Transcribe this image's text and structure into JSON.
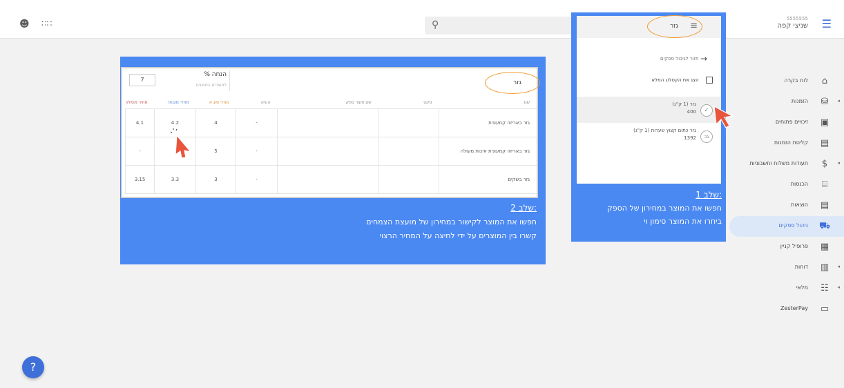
{
  "header": {
    "brand_number": "5555555",
    "brand_name": "שניצי קפה",
    "search_placeholder": ""
  },
  "sidebar": {
    "items": [
      {
        "label": "לוח בקרה",
        "icon": "home-icon",
        "has_arrow": false
      },
      {
        "label": "הזמנות",
        "icon": "cart-icon",
        "has_arrow": true
      },
      {
        "label": "זיכויים פתוחים",
        "icon": "clipboard-icon",
        "has_arrow": false
      },
      {
        "label": "קליטת הזמנות",
        "icon": "clipboard-list-icon",
        "has_arrow": false
      },
      {
        "label": "תעודות משלוח וחשבוניות",
        "icon": "dollar-icon",
        "has_arrow": true
      },
      {
        "label": "הכנסות",
        "icon": "cash-register-icon",
        "has_arrow": false
      },
      {
        "label": "הוצאות",
        "icon": "receipt-icon",
        "has_arrow": false
      },
      {
        "label": "ניהול ספקים",
        "icon": "truck-icon",
        "has_arrow": false,
        "active": true
      },
      {
        "label": "פרופיל קניין",
        "icon": "building-icon",
        "has_arrow": false
      },
      {
        "label": "דוחות",
        "icon": "chart-icon",
        "has_arrow": true
      },
      {
        "label": "מלאי",
        "icon": "grid-icon",
        "has_arrow": true
      },
      {
        "label": "ZesterPay",
        "icon": "card-icon",
        "has_arrow": false
      }
    ]
  },
  "step1": {
    "filter_text": "גזר",
    "back_link": "חזור לגיבול ספקים",
    "show_catalog": "הצג את הקטלוג המלא",
    "results": [
      {
        "name": "גזר (1 ק\"ג)",
        "value": "400",
        "avatar": ""
      },
      {
        "name": "גזר כתום קצוץ שערות (1 ק\"ג)",
        "value": "1392",
        "avatar": "גכ"
      }
    ],
    "title": "שלב 1:",
    "line1": "חפשו את המוצר במחירון של הספק",
    "line2": "ביחרו את המוצר סימון וי"
  },
  "step2": {
    "search_text": "גזר",
    "markup_label": "% הנחה",
    "markup_sub": "למוצרים המוצגים",
    "markup_value": "7",
    "columns": [
      "שם",
      "מקט",
      "שם מוצר ספק",
      "הנחה",
      "מחיר סוג א",
      "מחיר מובחר",
      "מחיר מומלץ"
    ],
    "rows": [
      {
        "name": "גזר באריזה קמעונית",
        "sku": "",
        "supplier": "",
        "discount": "-",
        "priceA": "4",
        "priceB": "4.2",
        "priceC": "4.1"
      },
      {
        "name": "גזר באריזה קמעונית איכות מעולה",
        "sku": "",
        "supplier": "",
        "discount": "-",
        "priceA": "5",
        "priceB": "",
        "priceC": "-"
      },
      {
        "name": "גזר בשקים",
        "sku": "",
        "supplier": "",
        "discount": "-",
        "priceA": "3",
        "priceB": "3.3",
        "priceC": "3.15"
      }
    ],
    "title": "שלב 2:",
    "line1": "חפשו את המוצר לקישור במחירון של מועצת הצמחים",
    "line2": "קשרו בין המוצרים על ידי לחיצה על המחיר הרצוי"
  },
  "help": {
    "label": "?"
  },
  "colors": {
    "accent": "#3f6fd8",
    "overlay": "#4a88f2",
    "highlight": "#f29a2e",
    "cursor": "#e8553d"
  }
}
